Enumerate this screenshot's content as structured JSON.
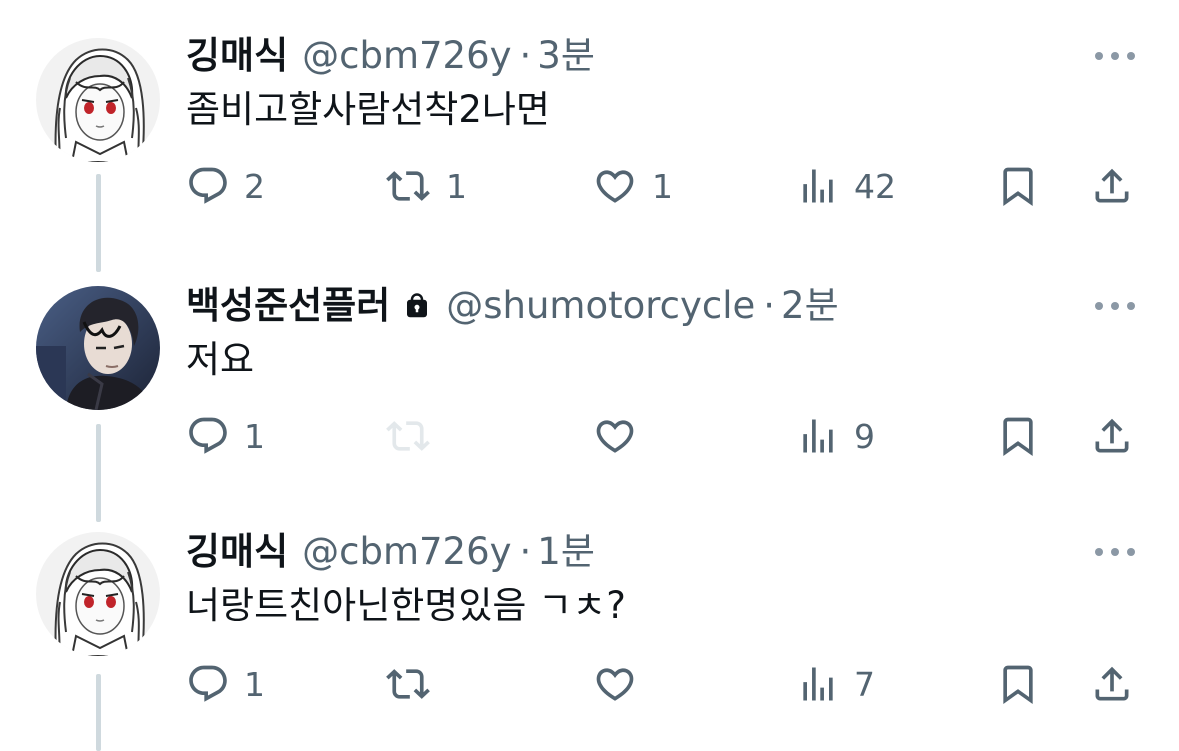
{
  "colors": {
    "text_primary": "#0f1419",
    "text_secondary": "#536471",
    "thread_line": "#cfd9de",
    "retweet_disabled": "#e3e8eb"
  },
  "tweets": [
    {
      "name": "깅매식",
      "locked": false,
      "handle": "@cbm726y",
      "separator": "·",
      "time": "3분",
      "text": "좀비고할사람선착2나면",
      "avatar": "anime-girl-avatar",
      "actions": {
        "reply_icon": "reply-icon",
        "reply_count": "2",
        "retweet_icon": "retweet-icon",
        "retweet_count": "1",
        "retweet_disabled": false,
        "like_icon": "heart-icon",
        "like_count": "1",
        "views_icon": "views-icon",
        "views_count": "42",
        "bookmark_icon": "bookmark-icon",
        "share_icon": "share-icon"
      }
    },
    {
      "name": "백성준선플러",
      "locked": true,
      "handle": "@shumotorcycle",
      "separator": "·",
      "time": "2분",
      "text": "저요",
      "avatar": "anime-boy-avatar",
      "actions": {
        "reply_icon": "reply-icon",
        "reply_count": "1",
        "retweet_icon": "retweet-icon",
        "retweet_count": "",
        "retweet_disabled": true,
        "like_icon": "heart-icon",
        "like_count": "",
        "views_icon": "views-icon",
        "views_count": "9",
        "bookmark_icon": "bookmark-icon",
        "share_icon": "share-icon"
      }
    },
    {
      "name": "깅매식",
      "locked": false,
      "handle": "@cbm726y",
      "separator": "·",
      "time": "1분",
      "text": "너랑트친아닌한명있음 ㄱㅊ?",
      "avatar": "anime-girl-avatar",
      "actions": {
        "reply_icon": "reply-icon",
        "reply_count": "1",
        "retweet_icon": "retweet-icon",
        "retweet_count": "",
        "retweet_disabled": false,
        "like_icon": "heart-icon",
        "like_count": "",
        "views_icon": "views-icon",
        "views_count": "7",
        "bookmark_icon": "bookmark-icon",
        "share_icon": "share-icon"
      }
    }
  ]
}
